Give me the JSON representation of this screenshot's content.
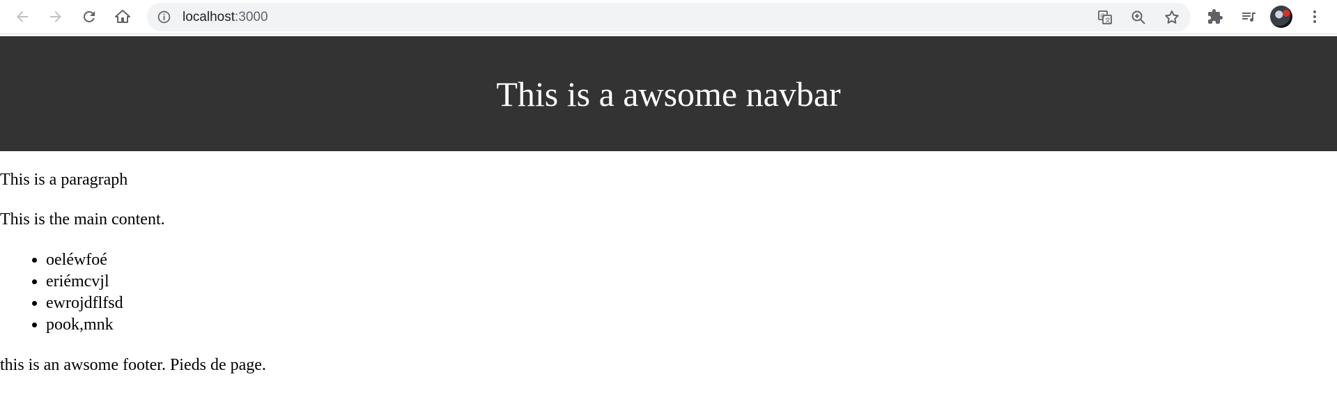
{
  "browser": {
    "url_host": "localhost",
    "url_port": ":3000",
    "icons": {
      "back": "arrow-left-icon",
      "forward": "arrow-right-icon",
      "reload": "reload-icon",
      "home": "home-icon",
      "info": "info-icon",
      "translate": "translate-icon",
      "zoom": "zoom-in-icon",
      "bookmark": "star-icon",
      "extensions": "puzzle-icon",
      "reading_list": "playlist-icon",
      "menu": "kebab-menu-icon"
    }
  },
  "page": {
    "navbar_title": "This is a awsome navbar",
    "paragraph": "This is a paragraph",
    "main_content": "This is the main content.",
    "list_items": [
      "oeléwfoé",
      "eriémcvjl",
      "ewrojdflfsd",
      "pook,mnk"
    ],
    "footer": "this is an awsome footer. Pieds de page."
  },
  "colors": {
    "navbar_bg": "#333333",
    "navbar_text": "#ffffff",
    "omnibox_bg": "#f1f3f4",
    "toolbar_icon": "#5f6368"
  }
}
